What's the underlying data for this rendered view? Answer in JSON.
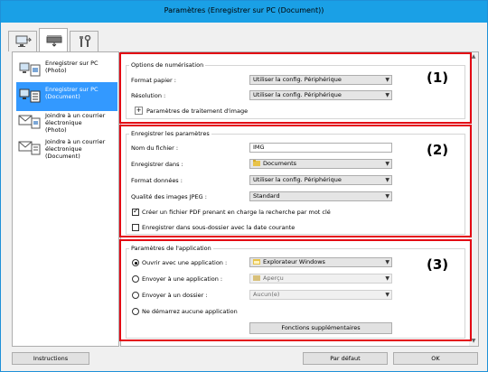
{
  "window": {
    "title": "Paramètres (Enregistrer sur PC (Document))"
  },
  "tabs": [
    {
      "name": "scan-from-computer",
      "icon": "computer-scan-icon"
    },
    {
      "name": "scan-from-panel",
      "icon": "scanner-icon"
    },
    {
      "name": "general-settings",
      "icon": "tools-icon"
    }
  ],
  "sidebar": {
    "items": [
      {
        "line1": "Enregistrer sur PC",
        "line2": "(Photo)",
        "line3": "",
        "icon": "save-photo-icon"
      },
      {
        "line1": "Enregistrer sur PC",
        "line2": "(Document)",
        "line3": "",
        "icon": "save-document-icon"
      },
      {
        "line1": "Joindre à un courrier",
        "line2": "électronique",
        "line3": "(Photo)",
        "icon": "mail-photo-icon"
      },
      {
        "line1": "Joindre à un courrier",
        "line2": "électronique",
        "line3": "(Document)",
        "icon": "mail-document-icon"
      }
    ],
    "selected_index": 1
  },
  "scan_options": {
    "title": "Options de numérisation",
    "number": "(1)",
    "paper_size_label": "Format papier :",
    "paper_size_value": "Utiliser la config. Périphérique",
    "resolution_label": "Résolution :",
    "resolution_value": "Utiliser la config. Périphérique",
    "image_processing_label": "Paramètres de traitement d'image",
    "expand_symbol": "+"
  },
  "save_settings": {
    "title": "Enregistrer les paramètres",
    "number": "(2)",
    "file_name_label": "Nom du fichier :",
    "file_name_value": "IMG",
    "save_in_label": "Enregistrer dans :",
    "save_in_value": "Documents",
    "data_format_label": "Format données :",
    "data_format_value": "Utiliser la config. Périphérique",
    "jpeg_quality_label": "Qualité des images JPEG :",
    "jpeg_quality_value": "Standard",
    "pdf_keyword_label": "Créer un fichier PDF prenant en charge la recherche par mot clé",
    "pdf_keyword_checked": true,
    "subfolder_label": "Enregistrer dans sous-dossier avec la date courante",
    "subfolder_checked": false
  },
  "app_settings": {
    "title": "Paramètres de l'application",
    "number": "(3)",
    "open_with_label": "Ouvrir avec une application :",
    "open_with_value": "Explorateur Windows",
    "send_to_app_label": "Envoyer à une application :",
    "send_to_app_value": "Aperçu",
    "send_to_folder_label": "Envoyer à un dossier :",
    "send_to_folder_value": "Aucun(e)",
    "no_app_label": "Ne démarrez aucune application",
    "selected_option": "open_with",
    "more_functions_label": "Fonctions supplémentaires"
  },
  "footer": {
    "instructions_label": "Instructions",
    "defaults_label": "Par défaut",
    "ok_label": "OK"
  },
  "colors": {
    "highlight": "#e30613",
    "selection": "#3399ff",
    "titlebar": "#1aa0e6"
  }
}
